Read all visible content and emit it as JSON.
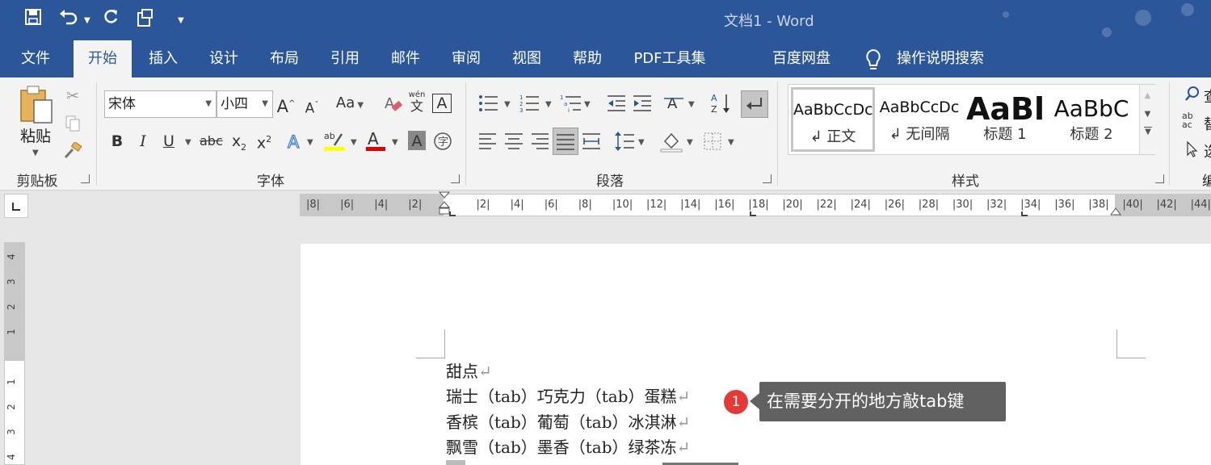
{
  "titlebar": {
    "title": "文档1  -  Word"
  },
  "tabs": [
    "文件",
    "开始",
    "插入",
    "设计",
    "布局",
    "引用",
    "邮件",
    "审阅",
    "视图",
    "帮助",
    "PDF工具集",
    "百度网盘",
    "操作说明搜索"
  ],
  "clipboard": {
    "paste_label": "粘贴",
    "group_label": "剪贴板"
  },
  "font": {
    "name": "宋体",
    "size": "小四",
    "group_label": "字体",
    "change_case": "Aa",
    "phonetic_top": "wén",
    "phonetic_char": "文",
    "char_border": "A"
  },
  "paragraph": {
    "group_label": "段落"
  },
  "styles": {
    "group_label": "样式",
    "items": [
      {
        "sample": "AaBbCcDc",
        "name": "↲ 正文"
      },
      {
        "sample": "AaBbCcDc",
        "name": "↲ 无间隔"
      },
      {
        "sample": "AaBl",
        "name": "标题 1"
      },
      {
        "sample": "AaBbC",
        "name": "标题 2"
      }
    ]
  },
  "editing": {
    "partial": [
      "查",
      "替",
      "选"
    ],
    "group_partial": "编"
  },
  "ruler": {
    "h_labels": [
      "8",
      "6",
      "4",
      "2",
      "",
      "2",
      "4",
      "6",
      "8",
      "10",
      "12",
      "14",
      "16",
      "18",
      "20",
      "22",
      "24",
      "26",
      "28",
      "30",
      "32",
      "34",
      "36",
      "38",
      "40",
      "42",
      "44"
    ],
    "v_labels": [
      "4",
      "3",
      "2",
      "1",
      "",
      "1",
      "2",
      "3",
      "4"
    ]
  },
  "document": {
    "lines": [
      "甜点",
      "瑞士（tab）巧克力（tab）蛋糕",
      "香槟（tab）葡萄（tab）冰淇淋",
      "飘雪（tab）墨香（tab）绿茶冻"
    ],
    "paragraph_mark": "↵"
  },
  "callout": {
    "badge": "1",
    "text": "在需要分开的地方敲tab键"
  },
  "colors": {
    "word_blue": "#2b579a",
    "highlight": "#ffff00",
    "font_red": "#e00000",
    "badge_red": "#e53935"
  }
}
